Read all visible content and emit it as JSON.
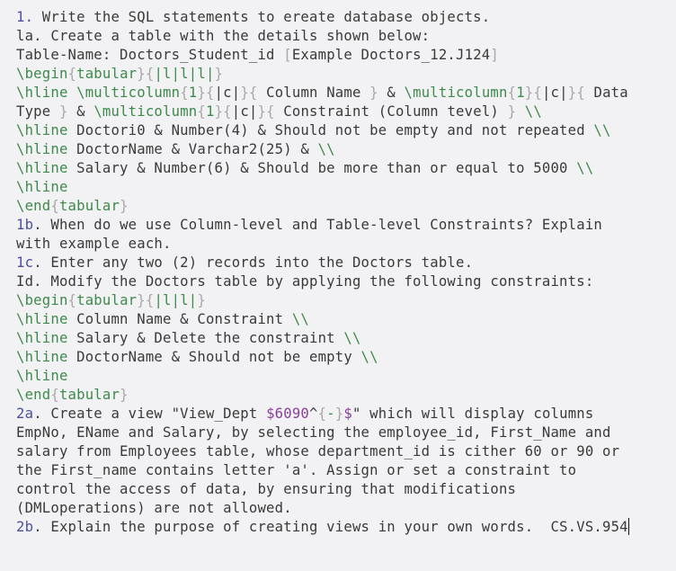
{
  "document": {
    "lines": [
      [
        {
          "t": "1.",
          "c": "num"
        },
        {
          "t": " Write the SQL statements to ereate database objects."
        }
      ],
      [
        {
          "t": "la. Create a table with the details shown below:"
        }
      ],
      [
        {
          "t": "Table-Name: Doctors_Student_id "
        },
        {
          "t": "[",
          "c": "brace"
        },
        {
          "t": "Example Doctors_12.J124"
        },
        {
          "t": "]",
          "c": "brace"
        }
      ],
      [
        {
          "t": "\\begin",
          "c": "cmd"
        },
        {
          "t": "{",
          "c": "brace"
        },
        {
          "t": "tabular",
          "c": "arg"
        },
        {
          "t": "}{",
          "c": "brace"
        },
        {
          "t": "|l|l|l|",
          "c": "arg"
        },
        {
          "t": "}",
          "c": "brace"
        }
      ],
      [
        {
          "t": "\\hline \\multicolumn",
          "c": "cmd"
        },
        {
          "t": "{",
          "c": "brace"
        },
        {
          "t": "1",
          "c": "arg"
        },
        {
          "t": "}{",
          "c": "brace"
        },
        {
          "t": "|c|"
        },
        {
          "t": "}{",
          "c": "brace"
        },
        {
          "t": " Column Name "
        },
        {
          "t": "}",
          "c": "brace"
        },
        {
          "t": " & "
        },
        {
          "t": "\\multicolumn",
          "c": "cmd"
        },
        {
          "t": "{",
          "c": "brace"
        },
        {
          "t": "1",
          "c": "arg"
        },
        {
          "t": "}{",
          "c": "brace"
        },
        {
          "t": "|c|"
        },
        {
          "t": "}{",
          "c": "brace"
        },
        {
          "t": " Data"
        }
      ],
      [
        {
          "t": "Type "
        },
        {
          "t": "}",
          "c": "brace"
        },
        {
          "t": " & "
        },
        {
          "t": "\\multicolumn",
          "c": "cmd"
        },
        {
          "t": "{",
          "c": "brace"
        },
        {
          "t": "1",
          "c": "arg"
        },
        {
          "t": "}{",
          "c": "brace"
        },
        {
          "t": "|c|"
        },
        {
          "t": "}{",
          "c": "brace"
        },
        {
          "t": " Constraint (Column tevel) "
        },
        {
          "t": "}",
          "c": "brace"
        },
        {
          "t": " \\\\",
          "c": "bslash"
        }
      ],
      [
        {
          "t": "\\hline",
          "c": "cmd"
        },
        {
          "t": " Doctori0 & Number(4) & Should not be empty and not repeated "
        },
        {
          "t": "\\\\",
          "c": "bslash"
        }
      ],
      [
        {
          "t": "\\hline",
          "c": "cmd"
        },
        {
          "t": " DoctorName & Varchar2(25) & "
        },
        {
          "t": "\\\\",
          "c": "bslash"
        }
      ],
      [
        {
          "t": "\\hline",
          "c": "cmd"
        },
        {
          "t": " Salary & Number(6) & Should be more than or equal to 5000 "
        },
        {
          "t": "\\\\",
          "c": "bslash"
        }
      ],
      [
        {
          "t": "\\hline",
          "c": "cmd"
        }
      ],
      [
        {
          "t": "\\end",
          "c": "cmd"
        },
        {
          "t": "{",
          "c": "brace"
        },
        {
          "t": "tabular",
          "c": "arg"
        },
        {
          "t": "}",
          "c": "brace"
        }
      ],
      [
        {
          "t": "1b",
          "c": "num"
        },
        {
          "t": ". When do we use Column-level and Table-level Constraints? Explain"
        }
      ],
      [
        {
          "t": "with example each."
        }
      ],
      [
        {
          "t": "1c",
          "c": "num"
        },
        {
          "t": ". Enter any two (2) records into the Doctors table."
        }
      ],
      [
        {
          "t": "Id. Modify the Doctors table by applying the following constraints:"
        }
      ],
      [
        {
          "t": "\\begin",
          "c": "cmd"
        },
        {
          "t": "{",
          "c": "brace"
        },
        {
          "t": "tabular",
          "c": "arg"
        },
        {
          "t": "}{",
          "c": "brace"
        },
        {
          "t": "|l|l|",
          "c": "arg"
        },
        {
          "t": "}",
          "c": "brace"
        }
      ],
      [
        {
          "t": "\\hline",
          "c": "cmd"
        },
        {
          "t": " Column Name & Constraint "
        },
        {
          "t": "\\\\",
          "c": "bslash"
        }
      ],
      [
        {
          "t": "\\hline",
          "c": "cmd"
        },
        {
          "t": " Salary & Delete the constraint "
        },
        {
          "t": "\\\\",
          "c": "bslash"
        }
      ],
      [
        {
          "t": "\\hline",
          "c": "cmd"
        },
        {
          "t": " DoctorName & Should not be empty "
        },
        {
          "t": "\\\\",
          "c": "bslash"
        }
      ],
      [
        {
          "t": "\\hline",
          "c": "cmd"
        }
      ],
      [
        {
          "t": "\\end",
          "c": "cmd"
        },
        {
          "t": "{",
          "c": "brace"
        },
        {
          "t": "tabular",
          "c": "arg"
        },
        {
          "t": "}",
          "c": "brace"
        }
      ],
      [
        {
          "t": "2a",
          "c": "num"
        },
        {
          "t": ". Create a view \"View_Dept "
        },
        {
          "t": "$6090",
          "c": "math"
        },
        {
          "t": "^"
        },
        {
          "t": "{",
          "c": "brace"
        },
        {
          "t": "-",
          "c": "arg"
        },
        {
          "t": "}",
          "c": "brace"
        },
        {
          "t": "$",
          "c": "math"
        },
        {
          "t": "\" which will display columns"
        }
      ],
      [
        {
          "t": "EmpNo, EName and Salary, by selecting the employee_id, First_Name and"
        }
      ],
      [
        {
          "t": "salary from Employees table, whose department_id is cither 60 or 90 or"
        }
      ],
      [
        {
          "t": "the First_name contains letter 'a'. Assign or set a constraint to"
        }
      ],
      [
        {
          "t": "control the access of data, by ensuring that modifications"
        }
      ],
      [
        {
          "t": "(DMLoperations) are not allowed."
        }
      ],
      [
        {
          "t": "2b",
          "c": "num"
        },
        {
          "t": ". Explain the purpose of creating views in your own words.  CS.VS.954"
        }
      ]
    ]
  }
}
